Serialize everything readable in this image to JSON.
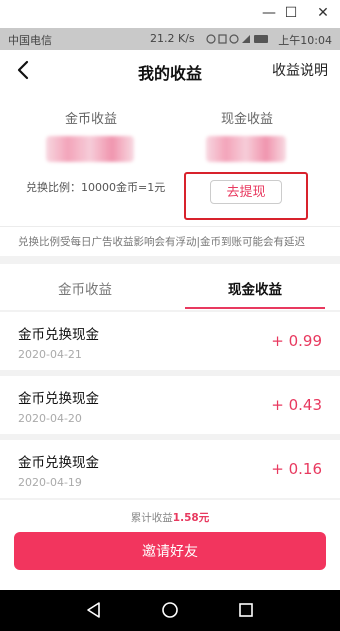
{
  "status_bar": {
    "carrier": "中国电信",
    "speed": "21.2 K/s",
    "time": "上午10:04"
  },
  "header": {
    "title": "我的收益",
    "explain_label": "收益说明"
  },
  "summary": {
    "coin_label": "金币收益",
    "cash_label": "现金收益",
    "exchange_rate": "兑换比例：10000金币=1元",
    "withdraw_label": "去提现",
    "note": "兑换比例受每日广告收益影响会有浮动|金币到账可能会有延迟"
  },
  "tabs": [
    {
      "label": "金币收益",
      "active": false
    },
    {
      "label": "现金收益",
      "active": true
    }
  ],
  "records": [
    {
      "title": "金币兑换现金",
      "date": "2020-04-21",
      "amount": "+ 0.99"
    },
    {
      "title": "金币兑换现金",
      "date": "2020-04-20",
      "amount": "+ 0.43"
    },
    {
      "title": "金币兑换现金",
      "date": "2020-04-19",
      "amount": "+ 0.16"
    }
  ],
  "footer": {
    "total_prefix": "累计收益",
    "total_amount": "1.58元",
    "invite_label": "邀请好友"
  },
  "colors": {
    "accent": "#e8395f",
    "highlight_box": "#d8222c"
  }
}
